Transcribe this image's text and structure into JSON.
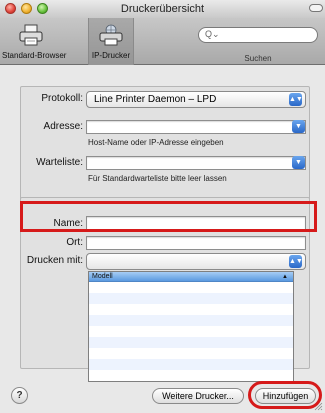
{
  "window": {
    "title": "Druckerübersicht"
  },
  "toolbar": {
    "items": [
      {
        "label": "Standard-Browser",
        "icon": "printer-icon"
      },
      {
        "label": "IP-Drucker",
        "icon": "network-printer-icon"
      }
    ],
    "search": {
      "glyph": "Q⌄",
      "label": "Suchen"
    }
  },
  "form": {
    "protocol": {
      "label": "Protokoll:",
      "value": "Line Printer Daemon – LPD"
    },
    "address": {
      "label": "Adresse:",
      "value": "",
      "hint": "Host-Name oder IP-Adresse eingeben"
    },
    "queue": {
      "label": "Warteliste:",
      "value": "",
      "hint": "Für Standardwarteliste bitte leer lassen"
    },
    "name": {
      "label": "Name:",
      "value": ""
    },
    "location": {
      "label": "Ort:",
      "value": ""
    },
    "print_with": {
      "label": "Drucken mit:",
      "value": ""
    },
    "model_list": {
      "header": "Modell",
      "rows": [
        "",
        "",
        "",
        "",
        "",
        "",
        "",
        "",
        ""
      ]
    }
  },
  "buttons": {
    "help": "?",
    "more_printers": "Weitere Drucker...",
    "add": "Hinzufügen"
  },
  "colors": {
    "highlight": "#d61a1a",
    "accent_blue": "#2a68c8"
  }
}
